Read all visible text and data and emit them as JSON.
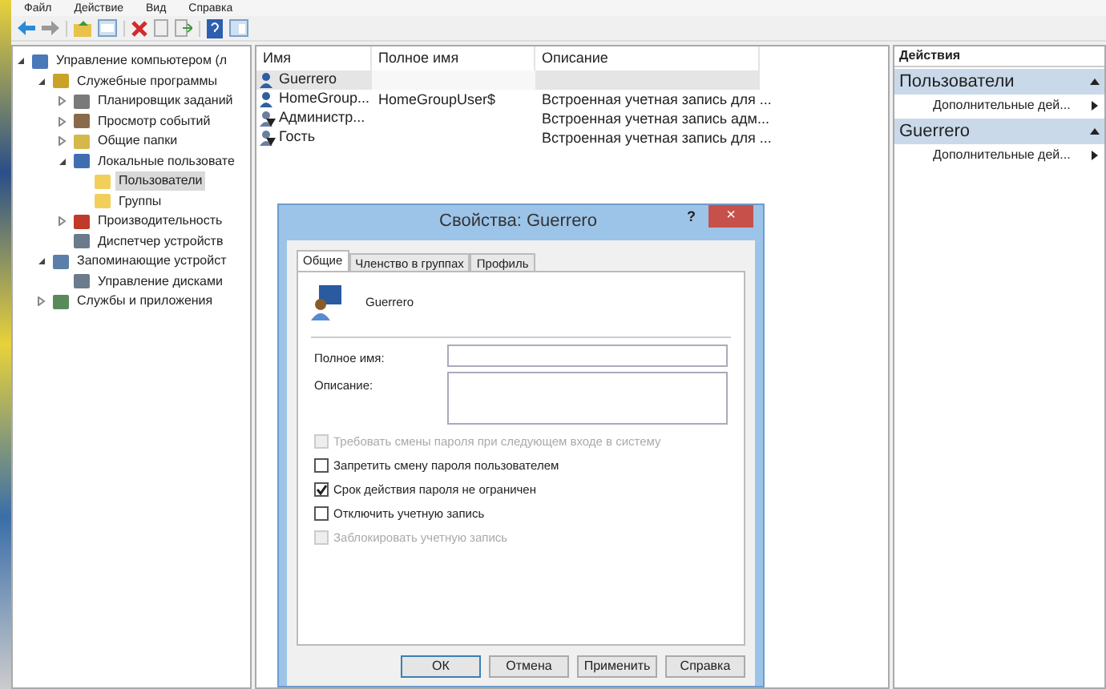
{
  "menu": [
    "Файл",
    "Действие",
    "Вид",
    "Справка"
  ],
  "tree": [
    {
      "label": "Управление компьютером (л",
      "expanded": true,
      "selected": false,
      "children": [
        {
          "label": "Служебные программы",
          "expanded": true,
          "selected": false,
          "children": [
            {
              "label": "Планировщик заданий",
              "expanded": false,
              "selected": false
            },
            {
              "label": "Просмотр событий",
              "expanded": false,
              "selected": false
            },
            {
              "label": "Общие папки",
              "expanded": false,
              "selected": false
            },
            {
              "label": "Локальные пользовате",
              "expanded": true,
              "selected": false,
              "children": [
                {
                  "label": "Пользователи",
                  "selected": true
                },
                {
                  "label": "Группы",
                  "selected": false
                }
              ]
            },
            {
              "label": "Производительность",
              "expanded": false,
              "selected": false
            },
            {
              "label": "Диспетчер устройств",
              "selected": false
            }
          ]
        },
        {
          "label": "Запоминающие устройст",
          "expanded": true,
          "selected": false,
          "children": [
            {
              "label": "Управление дисками",
              "selected": false
            }
          ]
        },
        {
          "label": "Службы и приложения",
          "expanded": false,
          "selected": false
        }
      ]
    }
  ],
  "list": {
    "columns": [
      "Имя",
      "Полное имя",
      "Описание"
    ],
    "rows": [
      {
        "name": "Guerrero",
        "full_name": "",
        "description": "",
        "disabled": false,
        "selected": true
      },
      {
        "name": "HomeGroup...",
        "full_name": "HomeGroupUser$",
        "description": "Встроенная учетная запись для ...",
        "disabled": false,
        "selected": false
      },
      {
        "name": "Администр...",
        "full_name": "",
        "description": "Встроенная учетная запись адм...",
        "disabled": true,
        "selected": false
      },
      {
        "name": "Гость",
        "full_name": "",
        "description": "Встроенная учетная запись для ...",
        "disabled": true,
        "selected": false
      }
    ]
  },
  "actions": {
    "title": "Действия",
    "sections": [
      {
        "title": "Пользователи",
        "items": [
          "Дополнительные дей..."
        ]
      },
      {
        "title": "Guerrero",
        "items": [
          "Дополнительные дей..."
        ]
      }
    ]
  },
  "dialog": {
    "title": "Свойства: Guerrero",
    "help": "?",
    "close": "×",
    "tabs": [
      {
        "label": "Общие",
        "selected": true
      },
      {
        "label": "Членство в группах",
        "selected": false
      },
      {
        "label": "Профиль",
        "selected": false
      }
    ],
    "user_name": "Guerrero",
    "fields": [
      {
        "label": "Полное имя:",
        "kind": "line"
      },
      {
        "label": "Описание:",
        "kind": "area"
      }
    ],
    "checkboxes": [
      {
        "label": "Требовать смены пароля при следующем входе в систему",
        "checked": false,
        "disabled": true
      },
      {
        "label": "Запретить смену пароля пользователем",
        "checked": false,
        "disabled": false
      },
      {
        "label": "Срок действия пароля не ограничен",
        "checked": true,
        "disabled": false
      },
      {
        "label": "Отключить учетную запись",
        "checked": false,
        "disabled": false
      },
      {
        "label": "Заблокировать учетную запись",
        "checked": false,
        "disabled": true
      }
    ],
    "buttons": [
      "ОК",
      "Отмена",
      "Применить",
      "Справка"
    ]
  }
}
